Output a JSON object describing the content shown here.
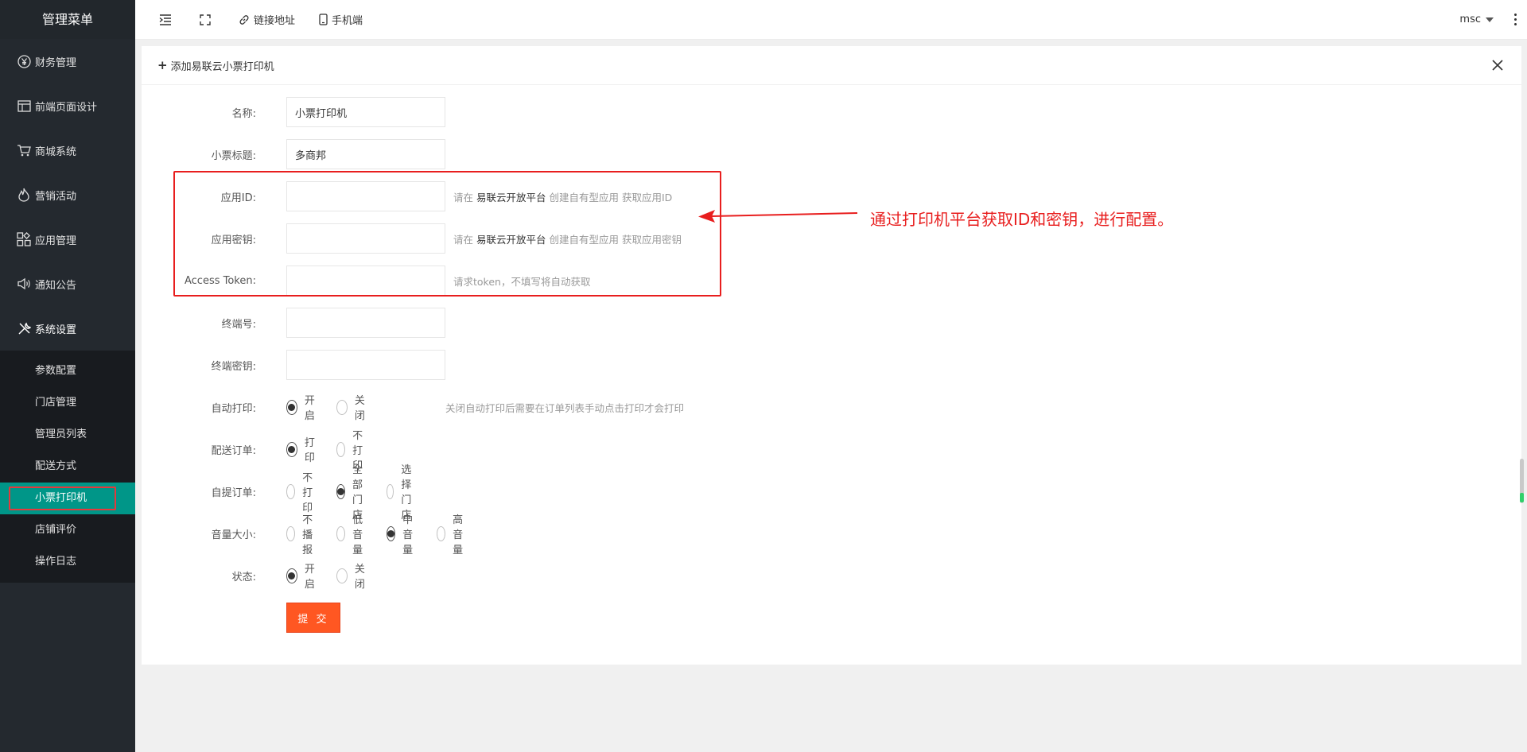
{
  "sidebar": {
    "title": "管理菜单",
    "items": [
      {
        "label": "财务管理",
        "icon": "yen-icon"
      },
      {
        "label": "前端页面设计",
        "icon": "layout-icon"
      },
      {
        "label": "商城系统",
        "icon": "cart-icon"
      },
      {
        "label": "营销活动",
        "icon": "fire-icon"
      },
      {
        "label": "应用管理",
        "icon": "apps-icon"
      },
      {
        "label": "通知公告",
        "icon": "speaker-icon"
      },
      {
        "label": "系统设置",
        "icon": "tools-icon"
      }
    ],
    "subitems": [
      "参数配置",
      "门店管理",
      "管理员列表",
      "配送方式",
      "小票打印机",
      "店铺评价",
      "操作日志"
    ],
    "active_subitem": "小票打印机"
  },
  "header": {
    "link_label": "链接地址",
    "mobile_label": "手机端",
    "user": "msc"
  },
  "card": {
    "title": "添加易联云小票打印机"
  },
  "form": {
    "name": {
      "label": "名称:",
      "value": "小票打印机"
    },
    "receipt_title": {
      "label": "小票标题:",
      "value": "多商邦"
    },
    "app_id": {
      "label": "应用ID:",
      "value": "",
      "tip_pre": "请在",
      "tip_link": "易联云开放平台",
      "tip_post": "创建自有型应用 获取应用ID"
    },
    "app_secret": {
      "label": "应用密钥:",
      "value": "",
      "tip_pre": "请在",
      "tip_link": "易联云开放平台",
      "tip_post": "创建自有型应用 获取应用密钥"
    },
    "access_token": {
      "label": "Access Token:",
      "value": "",
      "tip": "请求token，不填写将自动获取"
    },
    "terminal_no": {
      "label": "终端号:",
      "value": ""
    },
    "terminal_secret": {
      "label": "终端密钥:",
      "value": ""
    },
    "auto_print": {
      "label": "自动打印:",
      "options": [
        "开启",
        "关闭"
      ],
      "selected": "开启",
      "tip": "关闭自动打印后需要在订单列表手动点击打印才会打印"
    },
    "delivery_order": {
      "label": "配送订单:",
      "options": [
        "打印",
        "不打印"
      ],
      "selected": "打印"
    },
    "pickup_order": {
      "label": "自提订单:",
      "options": [
        "不打印",
        "全部门店",
        "选择门店"
      ],
      "selected": "全部门店"
    },
    "volume": {
      "label": "音量大小:",
      "options": [
        "不播报",
        "低音量",
        "中音量",
        "高音量"
      ],
      "selected": "中音量"
    },
    "status": {
      "label": "状态:",
      "options": [
        "开启",
        "关闭"
      ],
      "selected": "开启"
    },
    "submit_label": "提 交"
  },
  "annotation": {
    "text": "通过打印机平台获取ID和密钥，进行配置。",
    "color": "#e81e1e"
  },
  "colors": {
    "sidebar_bg": "#24292f",
    "active_bg": "#009688",
    "submit_bg": "#ff5722"
  }
}
